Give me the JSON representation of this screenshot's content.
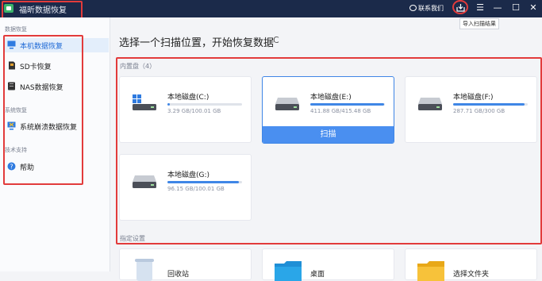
{
  "app": {
    "title": "福昕数据恢复",
    "contact_label": "联系我们",
    "import_tooltip": "导入扫描结果"
  },
  "window_controls": {
    "menu": "☰",
    "minimize": "—",
    "maximize": "☐",
    "close": "✕"
  },
  "sidebar": {
    "sections": [
      {
        "label": "数据恢复",
        "items": [
          {
            "label": "本机数据恢复",
            "icon": "monitor-icon",
            "active": true
          },
          {
            "label": "SD卡恢复",
            "icon": "sd-card-icon",
            "active": false
          },
          {
            "label": "NAS数据恢复",
            "icon": "nas-icon",
            "active": false
          }
        ]
      },
      {
        "label": "系统恢复",
        "items": [
          {
            "label": "系统崩溃数据恢复",
            "icon": "system-crash-icon",
            "active": false
          }
        ]
      },
      {
        "label": "技术支持",
        "items": [
          {
            "label": "帮助",
            "icon": "help-icon",
            "active": false
          }
        ]
      }
    ]
  },
  "main": {
    "title": "选择一个扫描位置，开始恢复数据",
    "refresh_glyph": "C",
    "internal_label": "内置盘（4）",
    "drives": [
      {
        "name": "本地磁盘(C:)",
        "size": "3.29 GB/100.01 GB",
        "used_fraction": 0.033,
        "icon": "windows-drive-icon",
        "selected": false
      },
      {
        "name": "本地磁盘(E:)",
        "size": "411.88 GB/415.48 GB",
        "used_fraction": 0.991,
        "icon": "hdd-icon",
        "selected": true
      },
      {
        "name": "本地磁盘(F:)",
        "size": "287.71 GB/300 GB",
        "used_fraction": 0.959,
        "icon": "hdd-icon",
        "selected": false
      },
      {
        "name": "本地磁盘(G:)",
        "size": "96.15 GB/100.01 GB",
        "used_fraction": 0.961,
        "icon": "hdd-icon",
        "selected": false
      }
    ],
    "scan_label": "扫描",
    "specified_label": "指定设置",
    "locations": [
      {
        "label": "回收站",
        "icon": "recycle-bin-icon"
      },
      {
        "label": "桌面",
        "icon": "desktop-folder-icon"
      },
      {
        "label": "选择文件夹",
        "icon": "folder-icon"
      }
    ]
  },
  "colors": {
    "titlebar": "#1b2a4a",
    "accent": "#3f86e6",
    "highlight": "#e23b3b"
  }
}
